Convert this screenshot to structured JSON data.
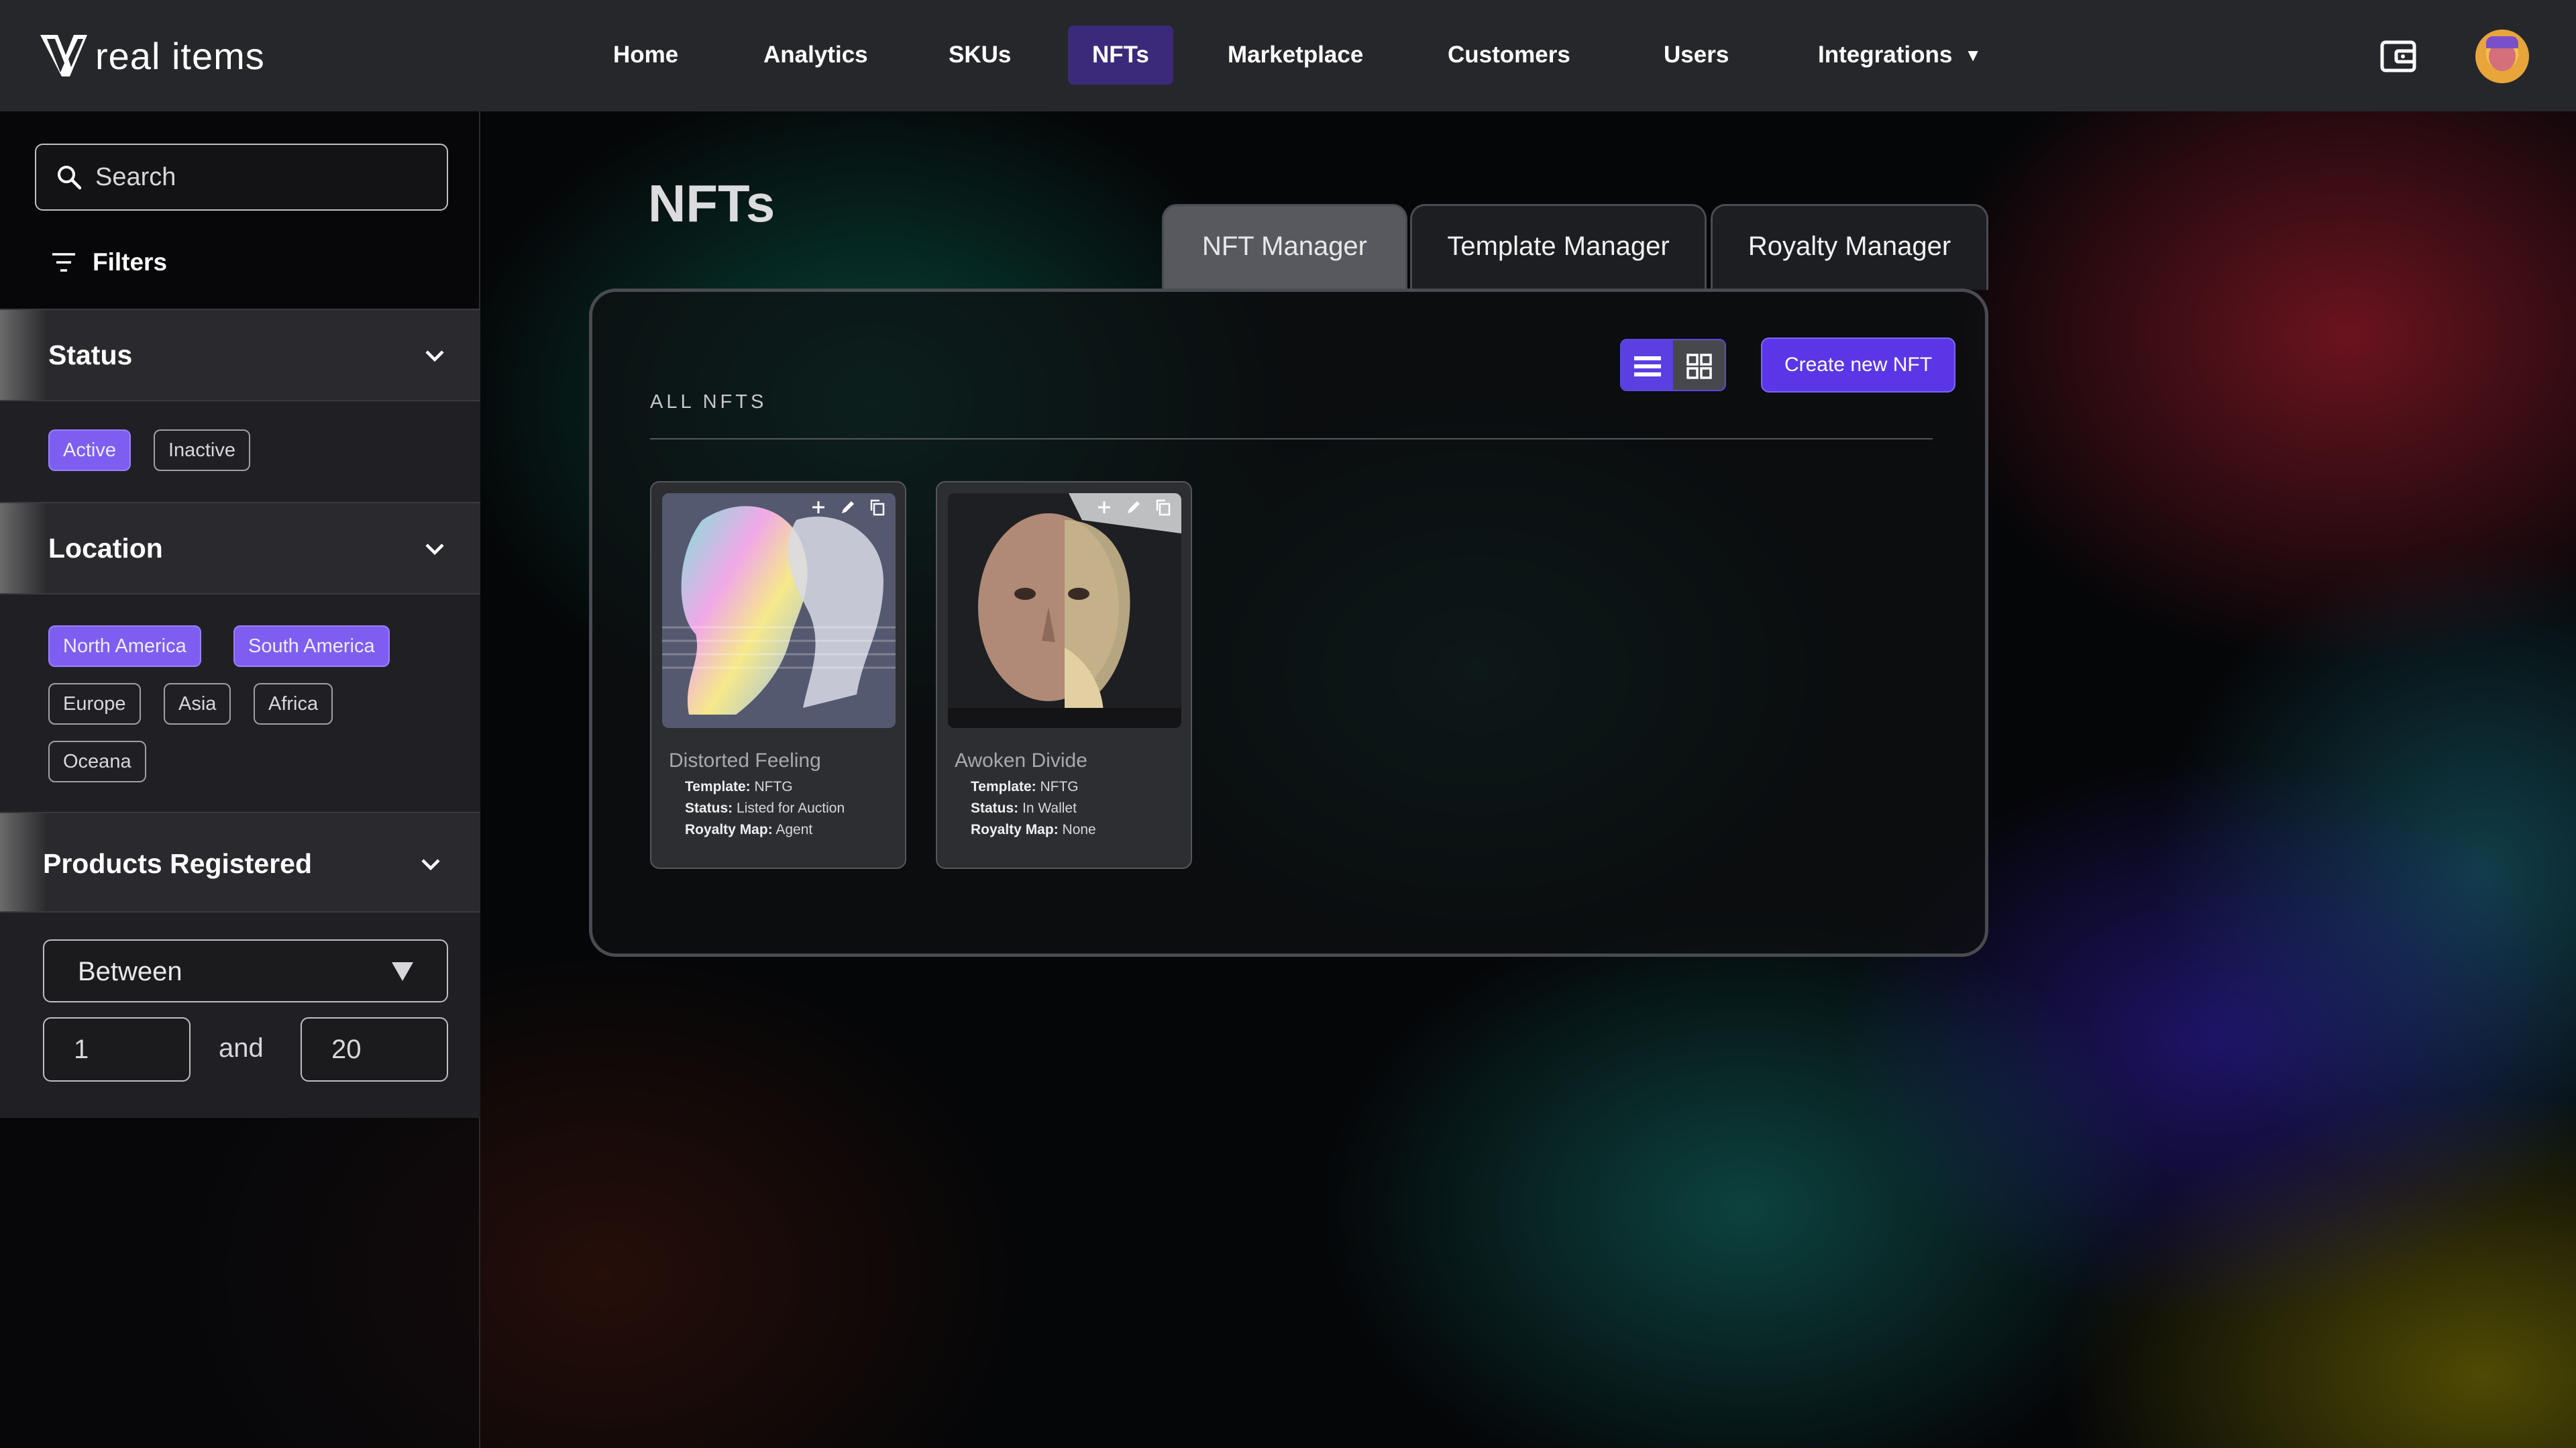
{
  "app": {
    "logo_text": "real items"
  },
  "nav": {
    "items": [
      {
        "label": "Home"
      },
      {
        "label": "Analytics"
      },
      {
        "label": "SKUs"
      },
      {
        "label": "NFTs"
      },
      {
        "label": "Marketplace"
      },
      {
        "label": "Customers"
      },
      {
        "label": "Users"
      },
      {
        "label": "Integrations"
      }
    ],
    "active": "NFTs"
  },
  "sidebar": {
    "search_placeholder": "Search",
    "filters_label": "Filters",
    "status": {
      "label": "Status",
      "options": [
        {
          "label": "Active",
          "selected": true
        },
        {
          "label": "Inactive",
          "selected": false
        }
      ]
    },
    "location": {
      "label": "Location",
      "options": [
        {
          "label": "North America",
          "selected": true
        },
        {
          "label": "South America",
          "selected": true
        },
        {
          "label": "Europe",
          "selected": false
        },
        {
          "label": "Asia",
          "selected": false
        },
        {
          "label": "Africa",
          "selected": false
        },
        {
          "label": "Oceana",
          "selected": false
        }
      ]
    },
    "products": {
      "label": "Products Registered",
      "operator": "Between",
      "min": "1",
      "and_label": "and",
      "max": "20"
    }
  },
  "main": {
    "title": "NFTs",
    "tabs": [
      {
        "label": "NFT Manager",
        "active": true
      },
      {
        "label": "Template Manager",
        "active": false
      },
      {
        "label": "Royalty Manager",
        "active": false
      }
    ],
    "section_label": "ALL NFTS",
    "create_button": "Create new NFT",
    "cards": [
      {
        "title": "Distorted Feeling",
        "template_key": "Template:",
        "template": "NFTG",
        "status_key": "Status:",
        "status": "Listed for Auction",
        "royalty_key": "Royalty Map:",
        "royalty": "Agent"
      },
      {
        "title": "Awoken Divide",
        "template_key": "Template:",
        "template": "NFTG",
        "status_key": "Status:",
        "status": "In Wallet",
        "royalty_key": "Royalty Map:",
        "royalty": "None"
      }
    ]
  },
  "colors": {
    "accent": "#5b36e6",
    "chip_selected": "#7e5ef0",
    "nav_active": "#3b2a7a",
    "topbar": "#26272b"
  }
}
